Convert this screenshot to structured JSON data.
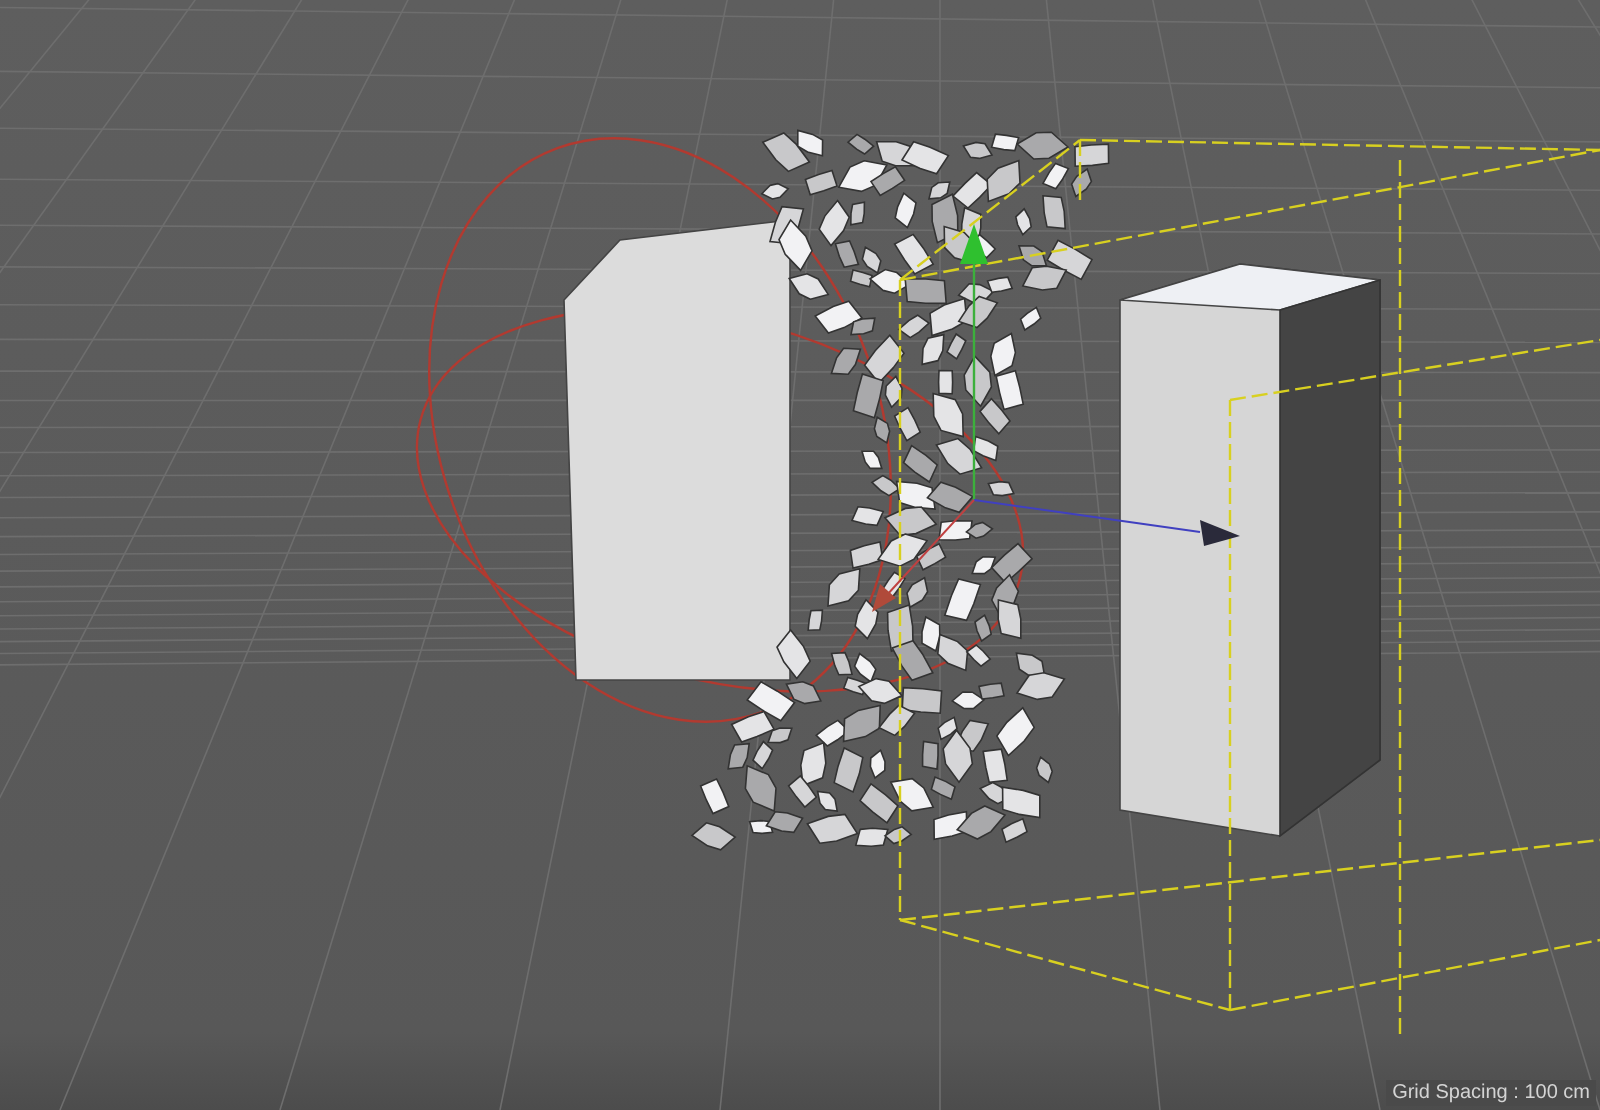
{
  "viewport": {
    "grid_spacing_label": "Grid Spacing : 100 cm"
  }
}
